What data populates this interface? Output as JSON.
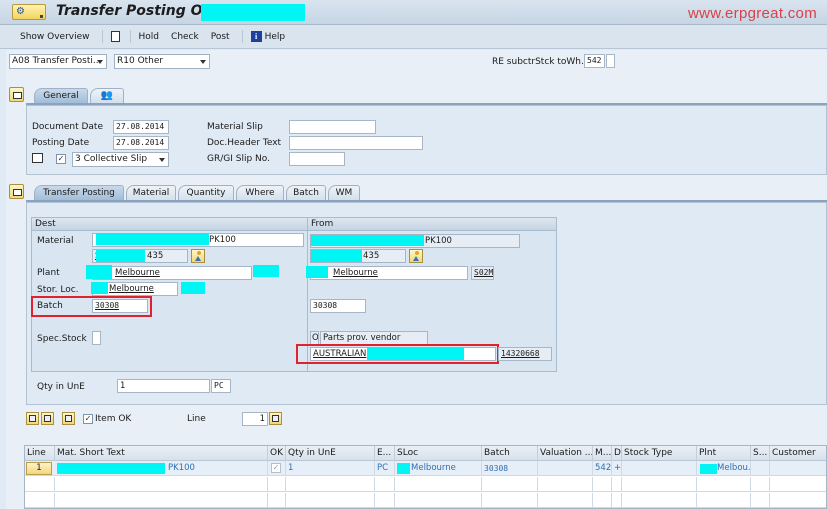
{
  "window": {
    "title": "Transfer Posting Other",
    "watermark": "www.erpgreat.com"
  },
  "toolbar": {
    "show_overview": "Show Overview",
    "new_doc_icon": "document-icon",
    "hold": "Hold",
    "check": "Check",
    "post": "Post",
    "help_icon_glyph": "i",
    "help": "Help"
  },
  "header": {
    "action_dropdown": "A08 Transfer Posti...",
    "reference_dropdown": "R10 Other",
    "movement_type_label": "RE subctrStck toWh...",
    "movement_type_value": "542",
    "special_stock_value": ""
  },
  "general_tabs": [
    {
      "label": "General",
      "active": true
    },
    {
      "label": "",
      "icon": "partner-icon",
      "active": false
    }
  ],
  "general": {
    "document_date_label": "Document Date",
    "document_date": "27.08.2014",
    "posting_date_label": "Posting Date",
    "posting_date": "27.08.2014",
    "print_checkbox_checked": true,
    "print_version": "3 Collective Slip",
    "material_slip_label": "Material Slip",
    "material_slip": "",
    "doc_header_text_label": "Doc.Header Text",
    "doc_header_text": "",
    "gr_gi_slip_label": "GR/GI Slip No.",
    "gr_gi_slip": ""
  },
  "item_tabs": [
    {
      "label": "Transfer Posting",
      "active": true
    },
    {
      "label": "Material",
      "active": false
    },
    {
      "label": "Quantity",
      "active": false
    },
    {
      "label": "Where",
      "active": false
    },
    {
      "label": "Batch",
      "active": false
    },
    {
      "label": "WM",
      "active": false
    }
  ],
  "dest": {
    "heading": "Dest",
    "material_label": "Material",
    "material_visible_suffix": "PK100",
    "material_number_prefix": "S",
    "material_number_suffix": "435",
    "plant_label": "Plant",
    "plant_name": "Melbourne",
    "stor_loc_label": "Stor. Loc.",
    "stor_loc_name": "Melbourne",
    "batch_label": "Batch",
    "batch": "30308",
    "spec_stock_label": "Spec.Stock",
    "spec_stock": ""
  },
  "from": {
    "heading": "From",
    "material_visible_suffix": "PK100",
    "material_number_suffix": "435",
    "plant_name": "Melbourne",
    "stor_loc_code": "S02M",
    "batch": "30308",
    "spec_stock_indicator": "O",
    "spec_stock_text": "Parts prov. vendor",
    "vendor_name_prefix": "AUSTRALIAN",
    "vendor_number": "14320668"
  },
  "quantity": {
    "label": "Qty in UnE",
    "value": "1",
    "unit": "PC"
  },
  "item_nav": {
    "item_ok_label": "Item OK",
    "item_ok_checked": true,
    "line_label": "Line",
    "line_value": "1"
  },
  "table": {
    "columns": [
      "Line",
      "Mat. Short Text",
      "OK",
      "Qty in UnE",
      "E...",
      "SLoc",
      "Batch",
      "Valuation ...",
      "M...",
      "D",
      "Stock Type",
      "Plnt",
      "S...",
      "Customer"
    ],
    "rows": [
      {
        "line": "1",
        "mat_short_text_suffix": "PK100",
        "ok": true,
        "qty": "1",
        "unit": "PC",
        "sloc": "Melbourne",
        "batch": "30308",
        "valuation": "",
        "mvt": "542",
        "debit_credit": "+",
        "stock_type": "",
        "plant": "Melbou...",
        "special": "",
        "customer": ""
      }
    ]
  },
  "colors": {
    "redaction": "#00f5f5",
    "highlight_border": "#e0222e",
    "watermark": "#d9404a",
    "table_value_text": "#2f6fb5"
  }
}
